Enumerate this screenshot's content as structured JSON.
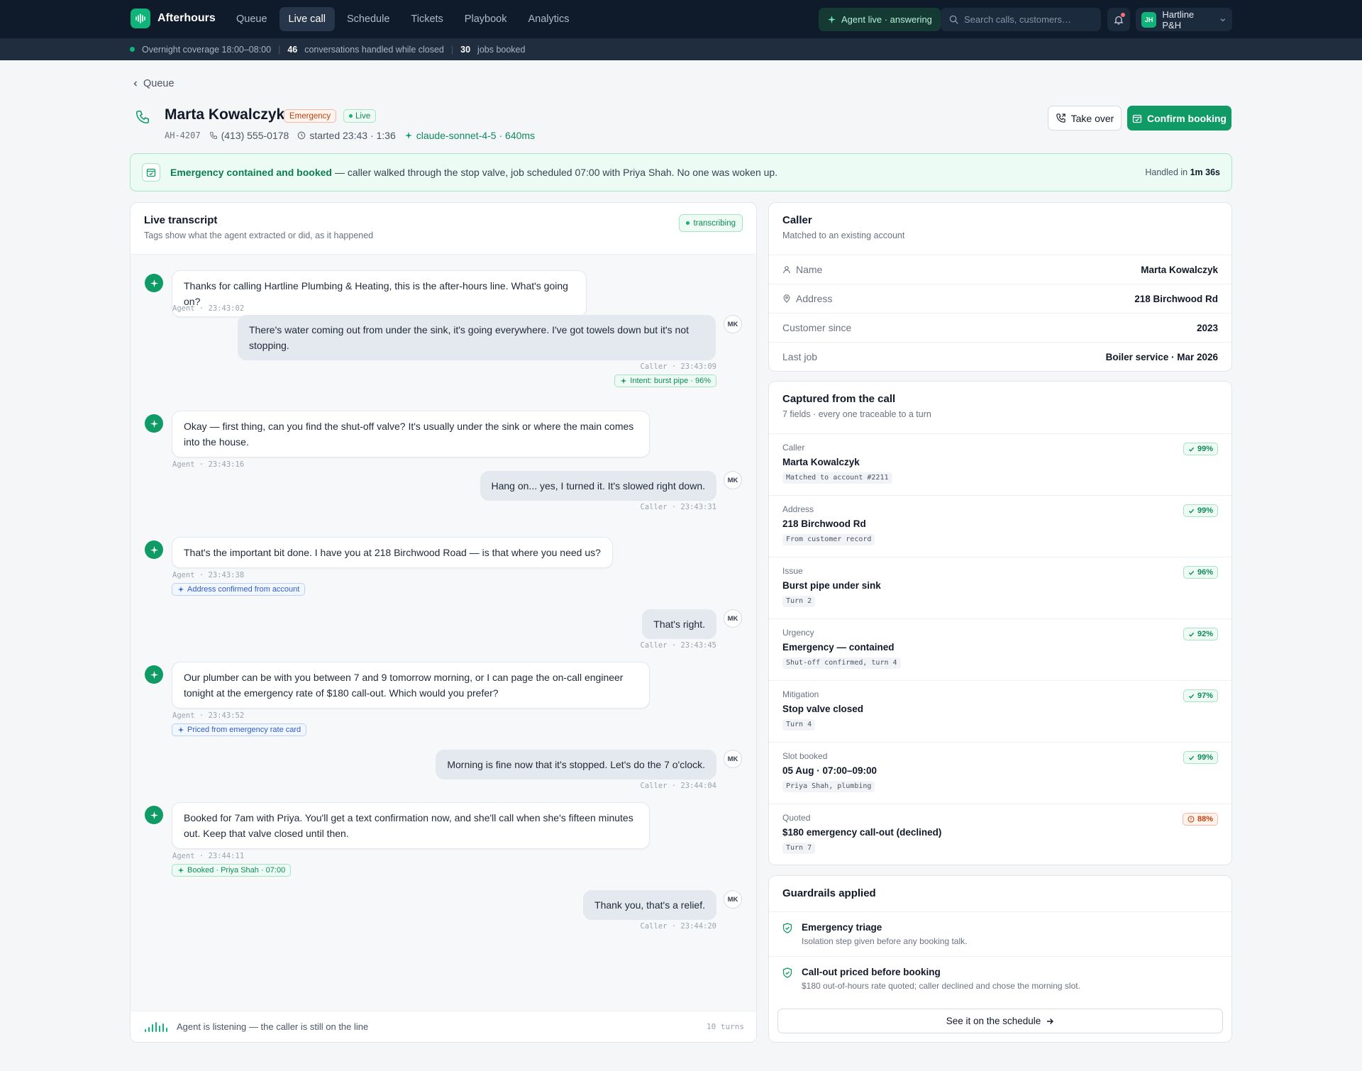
{
  "app": {
    "name": "Afterhours"
  },
  "nav": {
    "tabs": [
      {
        "label": "Queue"
      },
      {
        "label": "Live call"
      },
      {
        "label": "Schedule"
      },
      {
        "label": "Tickets"
      },
      {
        "label": "Playbook"
      },
      {
        "label": "Analytics"
      }
    ],
    "active_index": 1,
    "agent_status": "Agent live · answering",
    "search_placeholder": "Search calls, customers…",
    "org": {
      "initials": "JH",
      "name": "Hartline P&H"
    }
  },
  "subbar": {
    "coverage": "Overnight coverage 18:00–08:00",
    "conversations_count": "46",
    "conversations_label": "conversations handled while closed",
    "jobs_count": "30",
    "jobs_label": "jobs booked"
  },
  "header": {
    "back_label": "Queue",
    "caller_name": "Marta Kowalczyk",
    "badge_emergency": "Emergency",
    "badge_live": "Live",
    "call_id": "AH-4207",
    "phone": "(413) 555-0178",
    "started": "started 23:43 · 1:36",
    "model": "claude-sonnet-4-5 · 640ms",
    "take_over_label": "Take over",
    "confirm_label": "Confirm booking"
  },
  "banner": {
    "strong": "Emergency contained and booked",
    "text": "— caller walked through the stop valve, job scheduled 07:00 with Priya Shah. No one was woken up.",
    "handled_prefix": "Handled in",
    "handled_time": "1m 36s"
  },
  "transcript": {
    "title": "Live transcript",
    "subtitle": "Tags show what the agent extracted or did, as it happened",
    "status": "transcribing",
    "footer_text": "Agent is listening — the caller is still on the line",
    "turns": "10 turns",
    "caller_initials": "MK",
    "messages": [
      {
        "role": "agent",
        "text": "Thanks for calling Hartline Plumbing & Heating, this is the after-hours line. What's going on?",
        "stamp": "Agent · 23:43:02"
      },
      {
        "role": "caller",
        "text": "There's water coming out from under the sink, it's going everywhere. I've got towels down but it's not stopping.",
        "stamp": "Caller · 23:43:09",
        "tag": "Intent: burst pipe · 96%"
      },
      {
        "role": "agent",
        "text": "Okay — first thing, can you find the shut-off valve? It's usually under the sink or where the main comes into the house.",
        "stamp": "Agent · 23:43:16"
      },
      {
        "role": "caller",
        "text": "Hang on... yes, I turned it. It's slowed right down.",
        "stamp": "Caller · 23:43:31"
      },
      {
        "role": "agent",
        "text": "That's the important bit done. I have you at 218 Birchwood Road — is that where you need us?",
        "stamp": "Agent · 23:43:38",
        "tag": "Address confirmed from account"
      },
      {
        "role": "caller",
        "text": "That's right.",
        "stamp": "Caller · 23:43:45"
      },
      {
        "role": "agent",
        "text": "Our plumber can be with you between 7 and 9 tomorrow morning, or I can page the on-call engineer tonight at the emergency rate of $180 call-out. Which would you prefer?",
        "stamp": "Agent · 23:43:52",
        "tag": "Priced from emergency rate card"
      },
      {
        "role": "caller",
        "text": "Morning is fine now that it's stopped. Let's do the 7 o'clock.",
        "stamp": "Caller · 23:44:04"
      },
      {
        "role": "agent",
        "text": "Booked for 7am with Priya. You'll get a text confirmation now, and she'll call when she's fifteen minutes out. Keep that valve closed until then.",
        "stamp": "Agent · 23:44:11",
        "tag": "Booked · Priya Shah · 07:00"
      },
      {
        "role": "caller",
        "text": "Thank you, that's a relief.",
        "stamp": "Caller · 23:44:20"
      }
    ]
  },
  "caller_card": {
    "title": "Caller",
    "subtitle": "Matched to an existing account",
    "rows": [
      {
        "label": "Name",
        "value": "Marta Kowalczyk"
      },
      {
        "label": "Address",
        "value": "218 Birchwood Rd"
      },
      {
        "label": "Customer since",
        "value": "2023"
      },
      {
        "label": "Last job",
        "value": "Boiler service · Mar 2026"
      }
    ]
  },
  "captured": {
    "title": "Captured from the call",
    "subtitle": "7 fields · every one traceable to a turn",
    "fields": [
      {
        "label": "Caller",
        "value": "Marta Kowalczyk",
        "source": "Matched to account #2211",
        "confidence": "99%"
      },
      {
        "label": "Address",
        "value": "218 Birchwood Rd",
        "source": "From customer record",
        "confidence": "99%"
      },
      {
        "label": "Issue",
        "value": "Burst pipe under sink",
        "source": "Turn 2",
        "confidence": "96%"
      },
      {
        "label": "Urgency",
        "value": "Emergency — contained",
        "source": "Shut-off confirmed, turn 4",
        "confidence": "92%"
      },
      {
        "label": "Mitigation",
        "value": "Stop valve closed",
        "source": "Turn 4",
        "confidence": "97%"
      },
      {
        "label": "Slot booked",
        "value": "05 Aug · 07:00–09:00",
        "source": "Priya Shah, plumbing",
        "confidence": "99%"
      },
      {
        "label": "Quoted",
        "value": "$180 emergency call-out (declined)",
        "source": "Turn 7",
        "confidence": "88%"
      }
    ]
  },
  "guardrails": {
    "title": "Guardrails applied",
    "items": [
      {
        "title": "Emergency triage",
        "desc": "Isolation step given before any booking talk."
      },
      {
        "title": "Call-out priced before booking",
        "desc": "$180 out-of-hours rate quoted; caller declined and chose the morning slot."
      }
    ],
    "schedule_label": "See it on the schedule"
  },
  "colors": {
    "accent": "#0f9a66",
    "nav_bg": "#0f1b2b",
    "warn": "#c2410c"
  }
}
